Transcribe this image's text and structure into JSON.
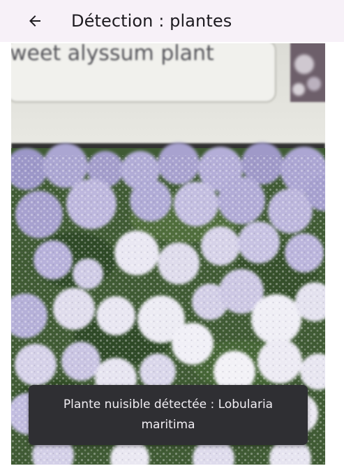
{
  "app_bar": {
    "back_icon": "arrow-back-icon",
    "title": "Détection : plantes"
  },
  "camera_feed": {
    "sign_text": "weet alyssum plant"
  },
  "snackbar": {
    "message": "Plante nuisible détectée : Lobularia maritima"
  },
  "colors": {
    "app_bar_background": "#f7f1f8",
    "snackbar_background": "#2f2f33",
    "snackbar_text": "#f2eff4"
  }
}
